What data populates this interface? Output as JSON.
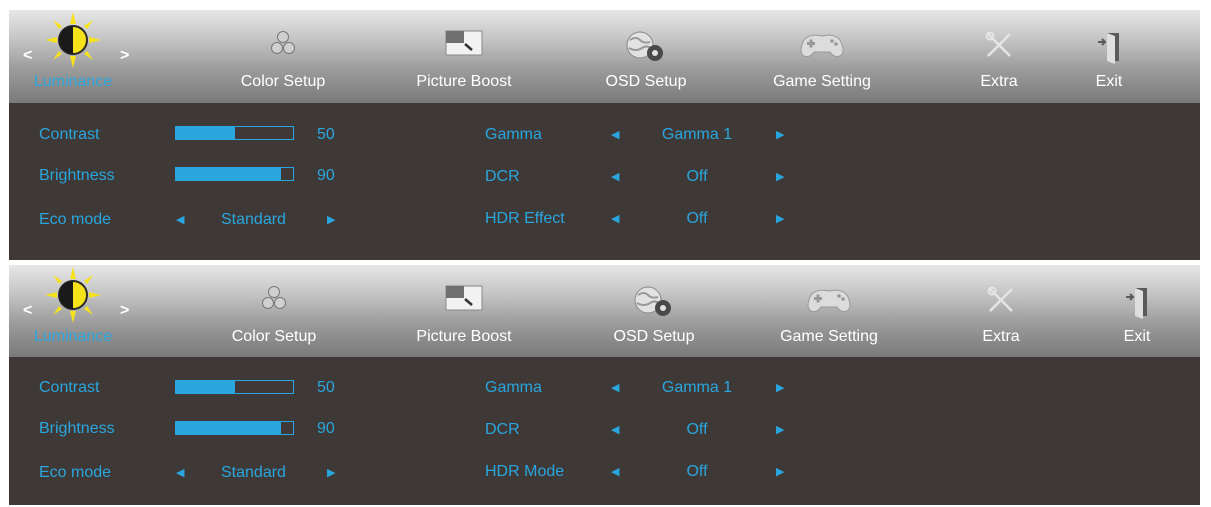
{
  "menus": [
    {
      "tabs": [
        "Luminance",
        "Color Setup",
        "Picture Boost",
        "OSD Setup",
        "Game Setting",
        "Extra",
        "Exit"
      ],
      "active_tab": "Luminance",
      "left": {
        "contrast_label": "Contrast",
        "contrast_value": "50",
        "contrast_level": 0.5,
        "brightness_label": "Brightness",
        "brightness_value": "90",
        "brightness_level": 0.9,
        "eco_label": "Eco mode",
        "eco_value": "Standard"
      },
      "right": {
        "gamma_label": "Gamma",
        "gamma_value": "Gamma 1",
        "dcr_label": "DCR",
        "dcr_value": "Off",
        "hdr_label": "HDR Effect",
        "hdr_value": "Off"
      }
    },
    {
      "tabs": [
        "Luminance",
        "Color Setup",
        "Picture Boost",
        "OSD Setup",
        "Game Setting",
        "Extra",
        "Exit"
      ],
      "active_tab": "Luminance",
      "left": {
        "contrast_label": "Contrast",
        "contrast_value": "50",
        "contrast_level": 0.5,
        "brightness_label": "Brightness",
        "brightness_value": "90",
        "brightness_level": 0.9,
        "eco_label": "Eco mode",
        "eco_value": "Standard"
      },
      "right": {
        "gamma_label": "Gamma",
        "gamma_value": "Gamma 1",
        "dcr_label": "DCR",
        "dcr_value": "Off",
        "hdr_label": "HDR Mode",
        "hdr_value": "Off"
      }
    }
  ],
  "colors": {
    "accent": "#2aa6de",
    "panel_bg": "#3e3936",
    "sun": "#f6e21b"
  },
  "icons": [
    "sun-contrast-icon",
    "color-dots-icon",
    "picture-boost-icon",
    "osd-globe-gear-icon",
    "gamepad-icon",
    "tools-icon",
    "exit-door-icon"
  ]
}
